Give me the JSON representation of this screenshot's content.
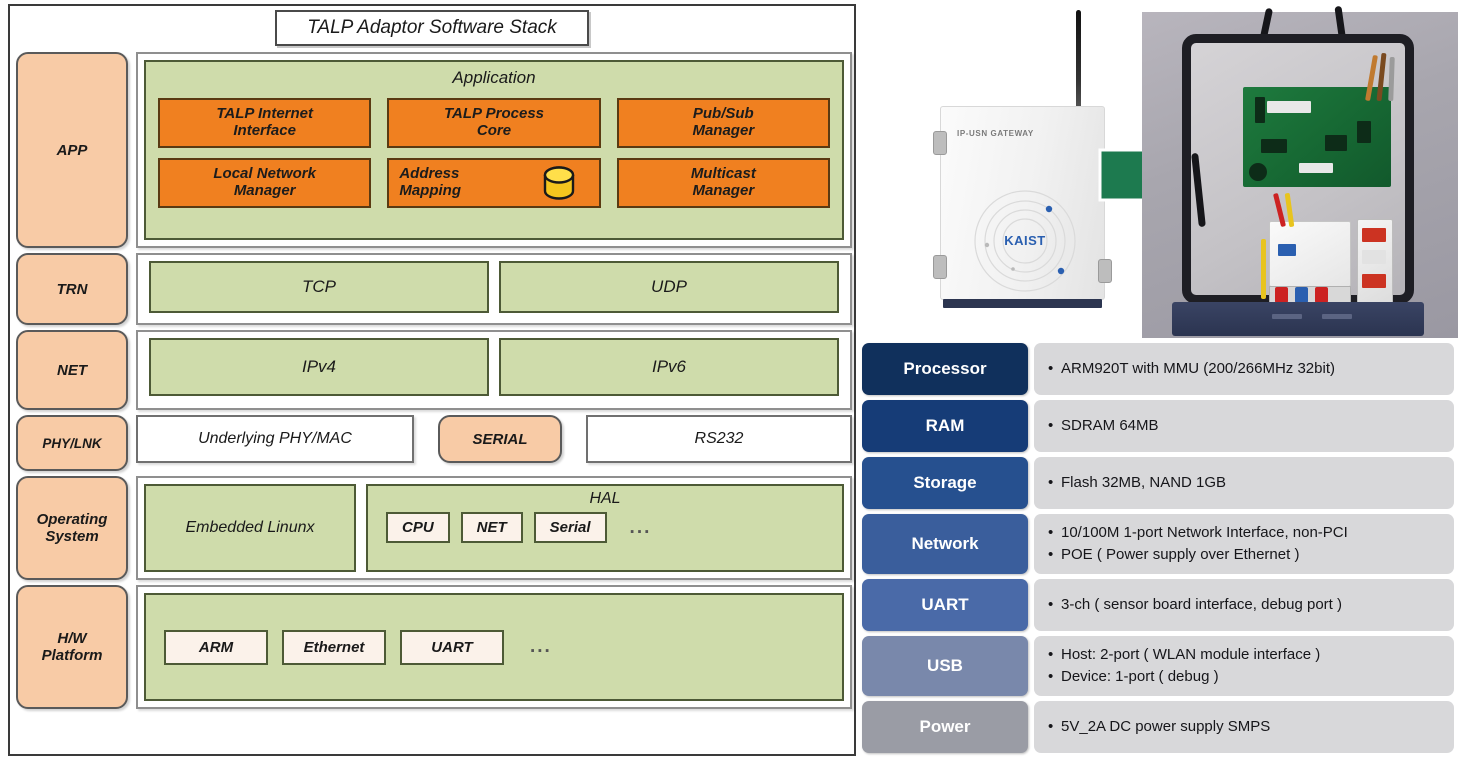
{
  "stack": {
    "title": "TALP Adaptor Software Stack",
    "layers": [
      {
        "label": "APP",
        "group_title": "Application",
        "cards": [
          "TALP Internet\nInterface",
          "TALP Process\nCore",
          "Pub/Sub\nManager",
          "Local Network\nManager",
          "Address\nMapping",
          "Multicast\nManager"
        ],
        "db_icon": "database-cylinder-icon"
      },
      {
        "label": "TRN",
        "items": [
          "TCP",
          "UDP"
        ]
      },
      {
        "label": "NET",
        "items": [
          "IPv4",
          "IPv6"
        ]
      },
      {
        "label": "PHY/LNK",
        "items": [
          "Underlying PHY/MAC",
          "SERIAL",
          "RS232"
        ]
      },
      {
        "label": "Operating\nSystem",
        "linux": "Embedded Linunx",
        "hal_title": "HAL",
        "hal_chips": [
          "CPU",
          "NET",
          "Serial"
        ],
        "hal_more": "..."
      },
      {
        "label": "H/W\nPlatform",
        "hw_chips": [
          "ARM",
          "Ethernet",
          "UART"
        ],
        "hw_more": "..."
      }
    ]
  },
  "photo": {
    "device_label": "IP-USN GATEWAY",
    "brand": "KAIST",
    "arrow": "right-arrow-icon"
  },
  "spec": {
    "rows": [
      {
        "key": "Processor",
        "color": "#10305c",
        "values": [
          "ARM920T with MMU (200/266MHz  32bit)"
        ]
      },
      {
        "key": "RAM",
        "color": "#163c77",
        "values": [
          "SDRAM 64MB"
        ]
      },
      {
        "key": "Storage",
        "color": "#26508f",
        "values": [
          "Flash 32MB, NAND 1GB"
        ]
      },
      {
        "key": "Network",
        "color": "#3a5e9c",
        "values": [
          "10/100M 1-port Network Interface, non-PCI",
          "POE ( Power supply over Ethernet )"
        ]
      },
      {
        "key": "UART",
        "color": "#4a6aa8",
        "values": [
          "3-ch ( sensor board interface, debug port )"
        ]
      },
      {
        "key": "USB",
        "color": "#7988ab",
        "values": [
          "Host: 2-port ( WLAN module interface )",
          "Device: 1-port ( debug )"
        ]
      },
      {
        "key": "Power",
        "color": "#9a9ca5",
        "values": [
          "5V_2A DC power supply SMPS"
        ]
      }
    ]
  },
  "colors": {
    "layer_label_bg": "#f8cba6",
    "green_group": "#cfdcab",
    "orange_card": "#f08020",
    "db_icon": "#f5c61e",
    "arrow_green": "#1d7a4f",
    "spec_value_bg": "#d8d8da"
  }
}
